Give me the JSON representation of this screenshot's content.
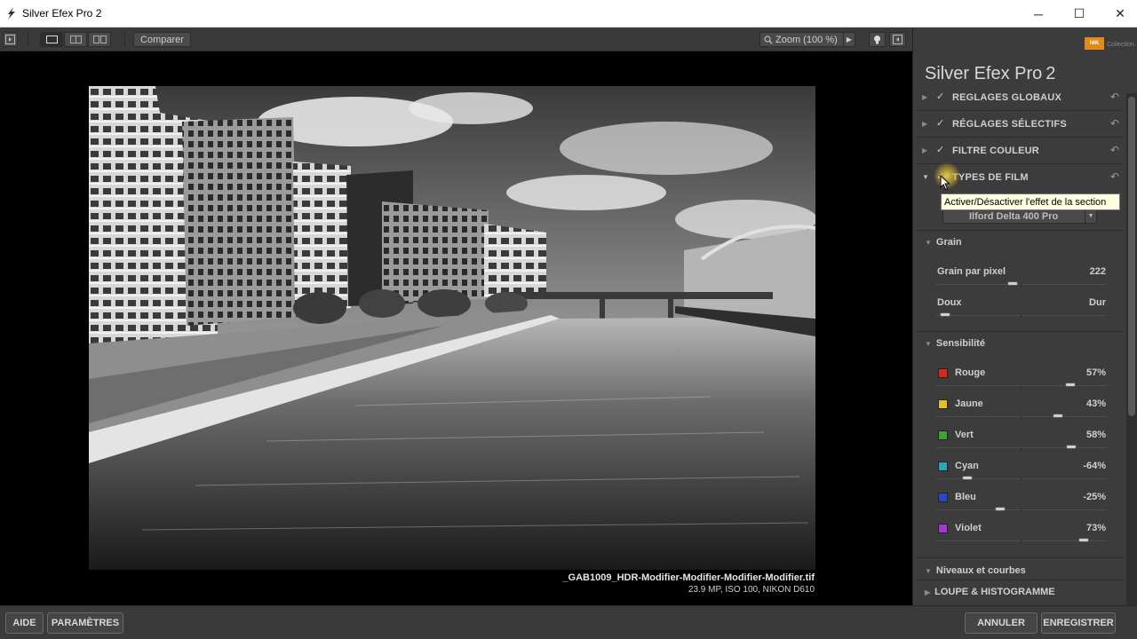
{
  "window": {
    "title": "Silver Efex Pro 2",
    "minimize_glyph": "─",
    "maximize_glyph": "☐",
    "close_glyph": "✕"
  },
  "toolbar": {
    "compare_label": "Comparer",
    "zoom_label": "Zoom (100 %)"
  },
  "image": {
    "file_name": "_GAB1009_HDR-Modifier-Modifier-Modifier-Modifier.tif",
    "meta": "23.9 MP, ISO 100, NIKON D610"
  },
  "footer": {
    "help_label": "AIDE",
    "settings_label": "PARAMÈTRES",
    "cancel_label": "ANNULER",
    "save_label": "ENREGISTRER"
  },
  "panel": {
    "nik_badge": "NIK",
    "collection_label": "Collection",
    "brand_name": "Silver Efex Pro",
    "brand_version": "2",
    "sections": [
      {
        "label": "REGLAGES GLOBAUX",
        "checked": true,
        "expanded": false
      },
      {
        "label": "RÉGLAGES SÉLECTIFS",
        "checked": true,
        "expanded": false
      },
      {
        "label": "FILTRE COULEUR",
        "checked": true,
        "expanded": false
      },
      {
        "label": "TYPES DE FILM",
        "checked": true,
        "expanded": true
      }
    ],
    "tooltip": "Activer/Désactiver l'effet de la section",
    "film_type": "Ilford Delta 400 Pro",
    "grain": {
      "header": "Grain",
      "per_pixel_label": "Grain par pixel",
      "per_pixel_value": "222",
      "per_pixel_position": 0.45,
      "soft_label": "Doux",
      "hard_label": "Dur",
      "softness_position": 0.05
    },
    "sensitivity": {
      "header": "Sensibilité",
      "channels": [
        {
          "label": "Rouge",
          "value": "57%",
          "color": "#d42a1e",
          "position": 0.785
        },
        {
          "label": "Jaune",
          "value": "43%",
          "color": "#e1c21e",
          "position": 0.715
        },
        {
          "label": "Vert",
          "value": "58%",
          "color": "#3aa535",
          "position": 0.79
        },
        {
          "label": "Cyan",
          "value": "-64%",
          "color": "#2aa6b8",
          "position": 0.18
        },
        {
          "label": "Bleu",
          "value": "-25%",
          "color": "#2748c7",
          "position": 0.375
        },
        {
          "label": "Violet",
          "value": "73%",
          "color": "#a13ad0",
          "position": 0.865
        }
      ]
    },
    "levels_header": "Niveaux et courbes",
    "loupe_header": "LOUPE & HISTOGRAMME"
  }
}
